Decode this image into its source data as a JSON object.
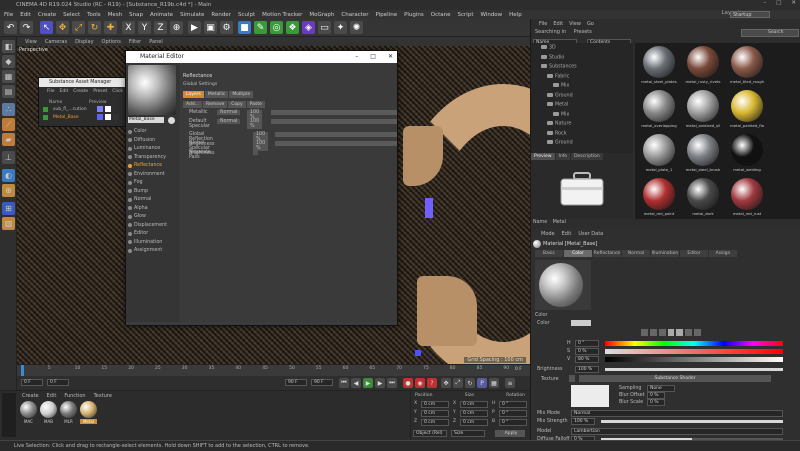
{
  "window": {
    "title": "CINEMA 4D R19.024 Studio (RC - R19) - [Substance_R19b.c4d *] - Main",
    "controls": [
      "–",
      "□",
      "✕"
    ]
  },
  "menubar": {
    "items": [
      "File",
      "Edit",
      "Create",
      "Select",
      "Tools",
      "Mesh",
      "Snap",
      "Animate",
      "Simulate",
      "Render",
      "Sculpt",
      "Motion Tracker",
      "MoGraph",
      "Character",
      "Pipeline",
      "Plugins",
      "Octane",
      "Script",
      "Window",
      "Help"
    ],
    "layout_label": "Layout:",
    "layout_value": "Startup"
  },
  "viewport": {
    "menu": [
      "View",
      "Cameras",
      "Display",
      "Options",
      "Filter",
      "Panel"
    ],
    "label": "Perspective",
    "grid_spacing": "Grid Spacing : 100 cm"
  },
  "timeline": {
    "ticks": [
      "0",
      "5",
      "10",
      "15",
      "20",
      "25",
      "30",
      "35",
      "40",
      "45",
      "50",
      "55",
      "60",
      "65",
      "70",
      "75",
      "80",
      "85",
      "90"
    ],
    "start_field": "0 F",
    "current_field": "0 F",
    "end_field": "90 F",
    "end_field2": "90 F",
    "frame_readout": "0 F"
  },
  "material_panel": {
    "menu": [
      "Create",
      "Edit",
      "Function",
      "Texture"
    ],
    "materials": [
      {
        "label": "MAC",
        "color": "#8a8a8a"
      },
      {
        "label": "MAB",
        "color": "#cfcfcf"
      },
      {
        "label": "MLR",
        "color": "#777777"
      },
      {
        "label": "Metal",
        "color": "#d4b06a"
      }
    ]
  },
  "coords": {
    "headers": [
      "Position",
      "Size",
      "Rotation"
    ],
    "rows": [
      {
        "axis": "X",
        "pos": "0 cm",
        "size": "0 cm",
        "rot_axis": "H",
        "rot": "0 °"
      },
      {
        "axis": "Y",
        "pos": "0 cm",
        "size": "0 cm",
        "rot_axis": "P",
        "rot": "0 °"
      },
      {
        "axis": "Z",
        "pos": "0 cm",
        "size": "0 cm",
        "rot_axis": "B",
        "rot": "0 °"
      }
    ],
    "mode": "Object (Rel)",
    "size_mode": "Size",
    "apply": "Apply"
  },
  "statusbar": {
    "text": "Live Selection: Click and drag to rectangle-select elements. Hold down SHIFT to add to the selection, CTRL to remove."
  },
  "content_browser": {
    "menu": [
      "File",
      "Edit",
      "View",
      "Go"
    ],
    "search_label": "Searching in",
    "search_value": "Presets",
    "filter_left": "Name",
    "filter_right": "Contents",
    "tree": [
      {
        "label": "3D",
        "indent": 1
      },
      {
        "label": "Studio",
        "indent": 1
      },
      {
        "label": "Substances",
        "indent": 1
      },
      {
        "label": "Fabric",
        "indent": 2
      },
      {
        "label": "Mix",
        "indent": 3
      },
      {
        "label": "Ground",
        "indent": 2
      },
      {
        "label": "Metal",
        "indent": 2
      },
      {
        "label": "Mix",
        "indent": 3
      },
      {
        "label": "Nature",
        "indent": 2
      },
      {
        "label": "Rock",
        "indent": 2
      },
      {
        "label": "Ground",
        "indent": 2
      }
    ],
    "preview_tabs": [
      "Preview",
      "Info",
      "Description"
    ],
    "name_label": "Name",
    "name_value": "Metal",
    "thumbs": [
      {
        "label": "metal_steel_plates",
        "color": "#6a6f75"
      },
      {
        "label": "metal_rusty_rivets",
        "color": "#7a4a3a"
      },
      {
        "label": "metal_tiled_rough",
        "color": "#8a5a4a"
      },
      {
        "label": "metal_overlapping",
        "color": "#8a8a8a"
      },
      {
        "label": "metal_oxidized_sil",
        "color": "#a0a0a0"
      },
      {
        "label": "metal_painted_fla",
        "color": "#d9b833"
      },
      {
        "label": "metal_plate_1",
        "color": "#9a9a9a"
      },
      {
        "label": "metal_steel_brush",
        "color": "#7d8086"
      },
      {
        "label": "metal_welding",
        "color": "#111111"
      },
      {
        "label": "metal_red_paint",
        "color": "#b03030"
      },
      {
        "label": "metal_dark",
        "color": "#4a4a4a"
      },
      {
        "label": "metal_red_rust",
        "color": "#a03a40"
      }
    ]
  },
  "attributes": {
    "menu": [
      "Mode",
      "Edit",
      "User Data"
    ],
    "title": "Material [Metal_Base]",
    "tabs": [
      "Basic",
      "Color",
      "Reflectance",
      "Normal",
      "Illumination",
      "Editor",
      "Assign"
    ],
    "section": "Color",
    "color_label": "Color",
    "h_label": "H",
    "h_value": "0 °",
    "s_label": "S",
    "s_value": "0 %",
    "v_label": "V",
    "v_value": "80 %",
    "brightness_label": "Brightness",
    "brightness_value": "100 %",
    "brightness_level": 1.0,
    "texture_label": "Texture",
    "texture_value": "Substance Shader",
    "sampling_label": "Sampling",
    "sampling_value": "None",
    "blur_offset_label": "Blur Offset",
    "blur_offset_value": "0 %",
    "blur_scale_label": "Blur Scale",
    "blur_scale_value": "0 %",
    "mix_mode_label": "Mix Mode",
    "mix_mode_value": "Normal",
    "mix_strength_label": "Mix Strength",
    "mix_strength_value": "100 %",
    "mix_strength_level": 1.0,
    "model_label": "Model",
    "model_value": "Lambertian",
    "diffuse_label": "Diffuse Falloff",
    "diffuse_value": "0 %",
    "diffuse_level": 0.5
  },
  "substance_manager": {
    "title": "Substance Asset Manager",
    "menu": [
      "File",
      "Edit",
      "Create",
      "Preset",
      "Click"
    ],
    "col_name": "Name",
    "col_preview": "Preview",
    "items": [
      "sub_fl_...cution",
      "Metal_Base"
    ]
  },
  "material_editor": {
    "title": "Material Editor",
    "mat_name": "Metal_Base",
    "channels": [
      {
        "label": "Color",
        "active": false
      },
      {
        "label": "Diffusion",
        "active": false
      },
      {
        "label": "Luminance",
        "active": false
      },
      {
        "label": "Transparency",
        "active": false
      },
      {
        "label": "Reflectance",
        "active": true
      },
      {
        "label": "Environment",
        "active": false
      },
      {
        "label": "Fog",
        "active": false
      },
      {
        "label": "Bump",
        "active": false
      },
      {
        "label": "Normal",
        "active": false
      },
      {
        "label": "Alpha",
        "active": false
      },
      {
        "label": "Glow",
        "active": false
      },
      {
        "label": "Displacement",
        "active": false
      },
      {
        "label": "Editor",
        "active": false
      },
      {
        "label": "Illumination",
        "active": false
      },
      {
        "label": "Assignment",
        "active": false
      }
    ],
    "section": "Reflectance",
    "global": "Global Settings",
    "tabs": [
      "Layers",
      "Metallic",
      "Multiple"
    ],
    "buttons": [
      "Add...",
      "Remove",
      "Copy",
      "Paste"
    ],
    "layers": [
      {
        "name": "Metallic",
        "mode": "Normal",
        "value": "100 %"
      },
      {
        "name": "Default Specular",
        "mode": "Normal",
        "value": "100 %"
      }
    ],
    "global_refl_label": "Global Reflection Brightness",
    "global_refl_value": "100 %",
    "global_spec_label": "Global Specular Brightness",
    "global_spec_value": "100 %",
    "separate_label": "Separate Pass"
  },
  "colors": {
    "accent": "#f0a030",
    "gold": "#c9a27a",
    "selection": "#6060ff"
  }
}
